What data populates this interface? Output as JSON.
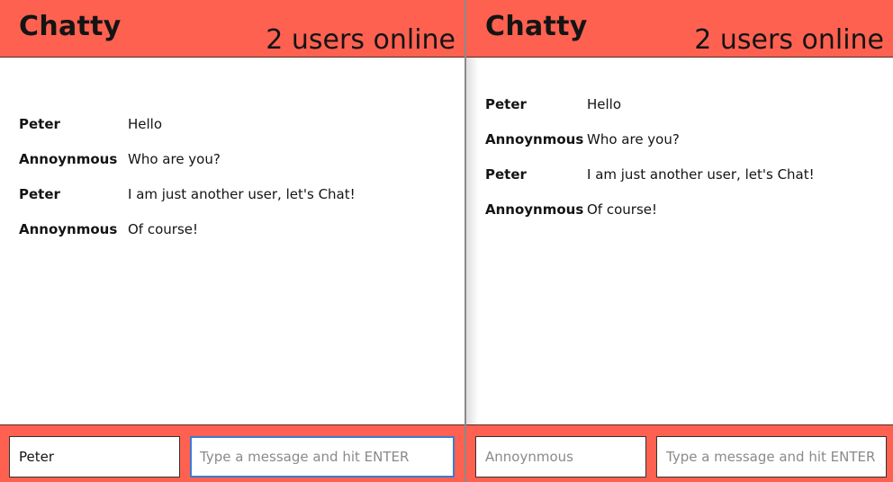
{
  "windows": [
    {
      "header": {
        "brand": "Chatty",
        "online": "2 users online"
      },
      "messages": [
        {
          "user": "Peter",
          "text": "Hello"
        },
        {
          "user": "Annoynmous",
          "text": "Who are you?"
        },
        {
          "user": "Peter",
          "text": "I am just another user, let's Chat!"
        },
        {
          "user": "Annoynmous",
          "text": "Of course!"
        }
      ],
      "footer": {
        "name_value": "Peter",
        "name_placeholder": "",
        "message_value": "",
        "message_placeholder": "Type a message and hit ENTER"
      }
    },
    {
      "header": {
        "brand": "Chatty",
        "online": "2 users online"
      },
      "messages": [
        {
          "user": "Peter",
          "text": "Hello"
        },
        {
          "user": "Annoynmous",
          "text": "Who are you?"
        },
        {
          "user": "Peter",
          "text": "I am just another user, let's Chat!"
        },
        {
          "user": "Annoynmous",
          "text": "Of course!"
        }
      ],
      "footer": {
        "name_value": "",
        "name_placeholder": "Annoynmous",
        "message_value": "",
        "message_placeholder": "Type a message and hit ENTER"
      }
    }
  ],
  "colors": {
    "brand": "#ff6150",
    "text": "#141414",
    "focus": "#3a7bd5"
  }
}
